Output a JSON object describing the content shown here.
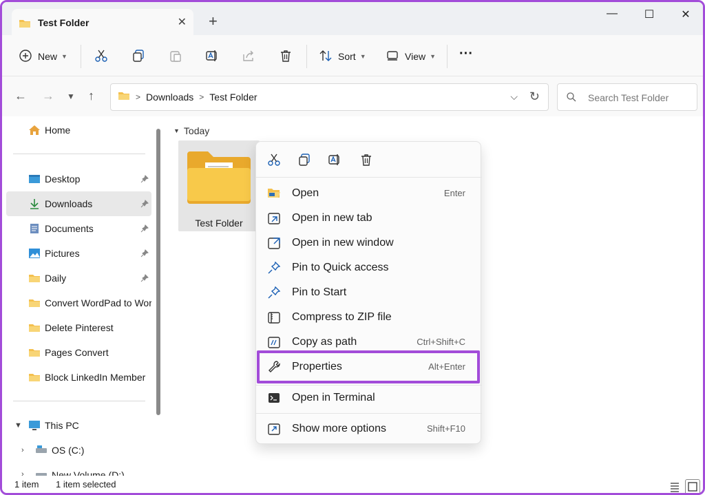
{
  "window": {
    "tab_title": "Test Folder",
    "new_tab_symbol": "+",
    "close_tab_symbol": "✕",
    "minimize_symbol": "—",
    "maximize_symbol": "☐",
    "close_symbol": "✕"
  },
  "toolbar": {
    "new_label": "New",
    "sort_label": "Sort",
    "view_label": "View",
    "more_symbol": "···",
    "icons": [
      "cut-icon",
      "copy-icon",
      "paste-icon",
      "rename-icon",
      "share-icon",
      "delete-icon"
    ]
  },
  "navigation": {
    "crumbs": [
      "Downloads",
      "Test Folder"
    ],
    "search_placeholder": "Search Test Folder"
  },
  "sidebar": {
    "home": "Home",
    "pinned": [
      {
        "label": "Desktop",
        "icon": "desktop-icon",
        "pinned": true
      },
      {
        "label": "Downloads",
        "icon": "downloads-icon",
        "pinned": true,
        "selected": true
      },
      {
        "label": "Documents",
        "icon": "documents-icon",
        "pinned": true
      },
      {
        "label": "Pictures",
        "icon": "pictures-icon",
        "pinned": true
      },
      {
        "label": "Daily",
        "icon": "folder-icon",
        "pinned": true
      },
      {
        "label": "Convert WordPad to Word",
        "icon": "folder-icon",
        "pinned": false
      },
      {
        "label": "Delete Pinterest",
        "icon": "folder-icon",
        "pinned": false
      },
      {
        "label": "Pages Convert",
        "icon": "folder-icon",
        "pinned": false
      },
      {
        "label": "Block LinkedIn Member",
        "icon": "folder-icon",
        "pinned": false
      }
    ],
    "this_pc": "This PC",
    "drives": [
      "OS (C:)",
      "New Volume (D:)"
    ]
  },
  "content": {
    "group_label": "Today",
    "items": [
      {
        "name": "Test Folder",
        "icon": "folder-icon",
        "selected": true
      }
    ]
  },
  "context_menu": {
    "quick_actions": [
      "cut-icon",
      "copy-icon",
      "rename-icon",
      "delete-icon"
    ],
    "items": [
      {
        "label": "Open",
        "shortcut": "Enter",
        "icon": "folder-open-icon"
      },
      {
        "label": "Open in new tab",
        "shortcut": "",
        "icon": "new-tab-icon"
      },
      {
        "label": "Open in new window",
        "shortcut": "",
        "icon": "new-window-icon"
      },
      {
        "label": "Pin to Quick access",
        "shortcut": "",
        "icon": "pin-icon"
      },
      {
        "label": "Pin to Start",
        "shortcut": "",
        "icon": "pin-icon"
      },
      {
        "label": "Compress to ZIP file",
        "shortcut": "",
        "icon": "zip-icon"
      },
      {
        "label": "Copy as path",
        "shortcut": "Ctrl+Shift+C",
        "icon": "copy-path-icon"
      },
      {
        "label": "Properties",
        "shortcut": "Alt+Enter",
        "icon": "wrench-icon",
        "highlighted": true
      },
      {
        "label": "Open in Terminal",
        "shortcut": "",
        "icon": "terminal-icon"
      },
      {
        "label": "Show more options",
        "shortcut": "Shift+F10",
        "icon": "more-options-icon"
      }
    ]
  },
  "status_bar": {
    "item_count": "1 item",
    "selected_count": "1 item selected"
  },
  "colors": {
    "highlight": "#a24cd9",
    "folder": "#f4c04e",
    "accent": "#0067c0"
  }
}
